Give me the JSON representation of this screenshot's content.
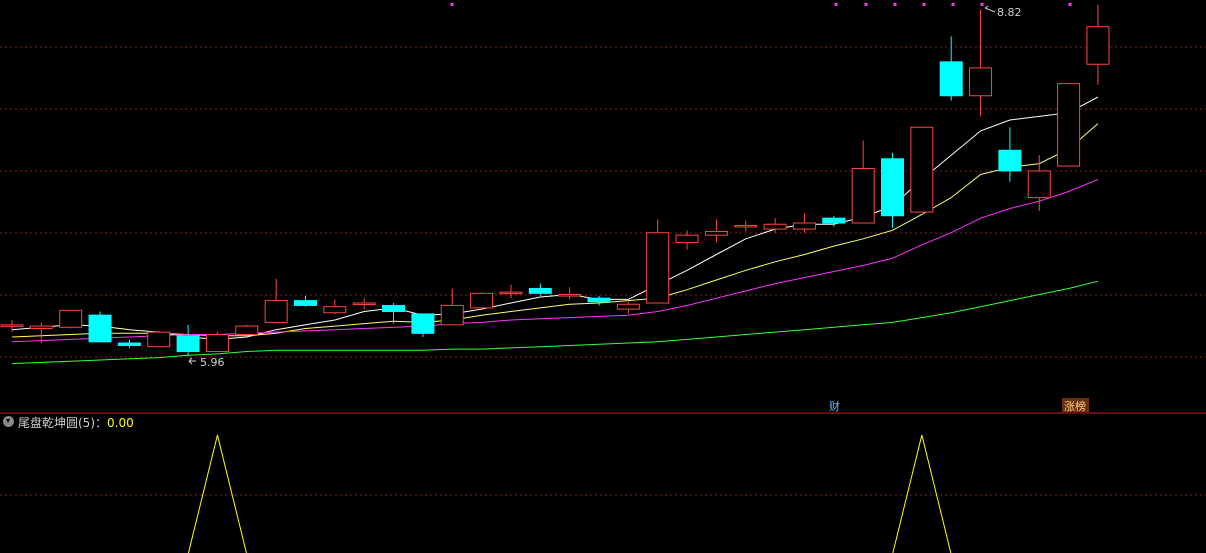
{
  "chart_data": {
    "type": "candlestick",
    "price_ylim": [
      5.6,
      8.9
    ],
    "candles": [
      {
        "o": 6.22,
        "c": 6.22,
        "h": 6.26,
        "l": 6.16
      },
      {
        "o": 6.19,
        "c": 6.21,
        "h": 6.24,
        "l": 6.07
      },
      {
        "o": 6.2,
        "c": 6.34,
        "h": 6.34,
        "l": 6.19
      },
      {
        "o": 6.3,
        "c": 6.08,
        "h": 6.33,
        "l": 6.08
      },
      {
        "o": 6.07,
        "c": 6.05,
        "h": 6.1,
        "l": 6.03
      },
      {
        "o": 6.04,
        "c": 6.16,
        "h": 6.17,
        "l": 6.04
      },
      {
        "o": 6.13,
        "c": 6.0,
        "h": 6.22,
        "l": 5.96
      },
      {
        "o": 6.0,
        "c": 6.14,
        "h": 6.16,
        "l": 6.0
      },
      {
        "o": 6.14,
        "c": 6.21,
        "h": 6.22,
        "l": 6.13
      },
      {
        "o": 6.24,
        "c": 6.42,
        "h": 6.6,
        "l": 6.24
      },
      {
        "o": 6.42,
        "c": 6.38,
        "h": 6.46,
        "l": 6.37
      },
      {
        "o": 6.32,
        "c": 6.37,
        "h": 6.43,
        "l": 6.31
      },
      {
        "o": 6.4,
        "c": 6.4,
        "h": 6.44,
        "l": 6.35
      },
      {
        "o": 6.38,
        "c": 6.33,
        "h": 6.4,
        "l": 6.23
      },
      {
        "o": 6.31,
        "c": 6.15,
        "h": 6.31,
        "l": 6.12
      },
      {
        "o": 6.22,
        "c": 6.38,
        "h": 6.52,
        "l": 6.22
      },
      {
        "o": 6.36,
        "c": 6.48,
        "h": 6.49,
        "l": 6.34
      },
      {
        "o": 6.49,
        "c": 6.49,
        "h": 6.55,
        "l": 6.44
      },
      {
        "o": 6.52,
        "c": 6.48,
        "h": 6.56,
        "l": 6.46
      },
      {
        "o": 6.46,
        "c": 6.47,
        "h": 6.53,
        "l": 6.43
      },
      {
        "o": 6.44,
        "c": 6.41,
        "h": 6.46,
        "l": 6.38
      },
      {
        "o": 6.35,
        "c": 6.39,
        "h": 6.41,
        "l": 6.31
      },
      {
        "o": 6.4,
        "c": 6.98,
        "h": 7.09,
        "l": 6.4
      },
      {
        "o": 6.9,
        "c": 6.96,
        "h": 7.0,
        "l": 6.84
      },
      {
        "o": 6.96,
        "c": 6.99,
        "h": 7.09,
        "l": 6.9
      },
      {
        "o": 7.04,
        "c": 7.04,
        "h": 7.08,
        "l": 6.99
      },
      {
        "o": 7.01,
        "c": 7.05,
        "h": 7.1,
        "l": 6.98
      },
      {
        "o": 7.01,
        "c": 7.06,
        "h": 7.14,
        "l": 6.98
      },
      {
        "o": 7.1,
        "c": 7.06,
        "h": 7.12,
        "l": 7.03
      },
      {
        "o": 7.06,
        "c": 7.51,
        "h": 7.74,
        "l": 7.06
      },
      {
        "o": 7.59,
        "c": 7.12,
        "h": 7.64,
        "l": 7.02
      },
      {
        "o": 7.15,
        "c": 7.85,
        "h": 7.85,
        "l": 7.15
      },
      {
        "o": 8.39,
        "c": 8.11,
        "h": 8.6,
        "l": 8.07
      },
      {
        "o": 8.11,
        "c": 8.34,
        "h": 8.82,
        "l": 7.94
      },
      {
        "o": 7.66,
        "c": 7.49,
        "h": 7.85,
        "l": 7.4
      },
      {
        "o": 7.27,
        "c": 7.49,
        "h": 7.62,
        "l": 7.16
      },
      {
        "o": 7.53,
        "c": 8.21,
        "h": 8.21,
        "l": 7.53
      },
      {
        "o": 8.37,
        "c": 8.68,
        "h": 8.86,
        "l": 8.2
      }
    ],
    "ma_series": [
      {
        "color": "#ffffff",
        "values": [
          6.18,
          6.2,
          6.22,
          6.21,
          6.18,
          6.16,
          6.12,
          6.1,
          6.12,
          6.18,
          6.22,
          6.26,
          6.33,
          6.36,
          6.3,
          6.31,
          6.35,
          6.4,
          6.45,
          6.47,
          6.43,
          6.43,
          6.55,
          6.67,
          6.8,
          6.93,
          7.01,
          7.05,
          7.05,
          7.11,
          7.2,
          7.42,
          7.62,
          7.82,
          7.91,
          7.94,
          7.97,
          8.1
        ]
      },
      {
        "color": "#ffff66",
        "values": [
          6.12,
          6.13,
          6.14,
          6.15,
          6.15,
          6.15,
          6.14,
          6.13,
          6.13,
          6.15,
          6.19,
          6.21,
          6.23,
          6.25,
          6.24,
          6.26,
          6.3,
          6.33,
          6.36,
          6.39,
          6.4,
          6.42,
          6.44,
          6.51,
          6.59,
          6.67,
          6.74,
          6.8,
          6.87,
          6.93,
          7.0,
          7.13,
          7.27,
          7.46,
          7.52,
          7.55,
          7.67,
          7.88
        ]
      },
      {
        "color": "#ff33ff",
        "values": [
          6.08,
          6.09,
          6.1,
          6.11,
          6.12,
          6.13,
          6.14,
          6.14,
          6.15,
          6.16,
          6.17,
          6.18,
          6.19,
          6.2,
          6.21,
          6.23,
          6.24,
          6.26,
          6.27,
          6.28,
          6.29,
          6.3,
          6.33,
          6.38,
          6.44,
          6.5,
          6.56,
          6.61,
          6.66,
          6.71,
          6.77,
          6.88,
          6.98,
          7.1,
          7.18,
          7.24,
          7.32,
          7.42
        ]
      },
      {
        "color": "#33ff33",
        "values": [
          5.9,
          5.91,
          5.92,
          5.93,
          5.94,
          5.95,
          5.97,
          5.98,
          6.0,
          6.01,
          6.01,
          6.01,
          6.01,
          6.01,
          6.01,
          6.02,
          6.02,
          6.03,
          6.04,
          6.05,
          6.06,
          6.07,
          6.08,
          6.1,
          6.12,
          6.14,
          6.16,
          6.18,
          6.2,
          6.22,
          6.24,
          6.28,
          6.32,
          6.37,
          6.42,
          6.47,
          6.52,
          6.58
        ]
      }
    ],
    "annotations": {
      "low_label": "5.96",
      "high_label": "8.82",
      "event_cai": "财",
      "event_zhangbang": "涨榜"
    },
    "indicator": {
      "title": "尾盘乾坤圆(5)",
      "value": "0.00",
      "peaks_at_candle": [
        7,
        31
      ]
    },
    "colors": {
      "up": "#ff4444",
      "down": "#00ffff",
      "grid": "#8b1a1a",
      "indicator": "#ffff00",
      "label": "#d0d0d0"
    }
  }
}
